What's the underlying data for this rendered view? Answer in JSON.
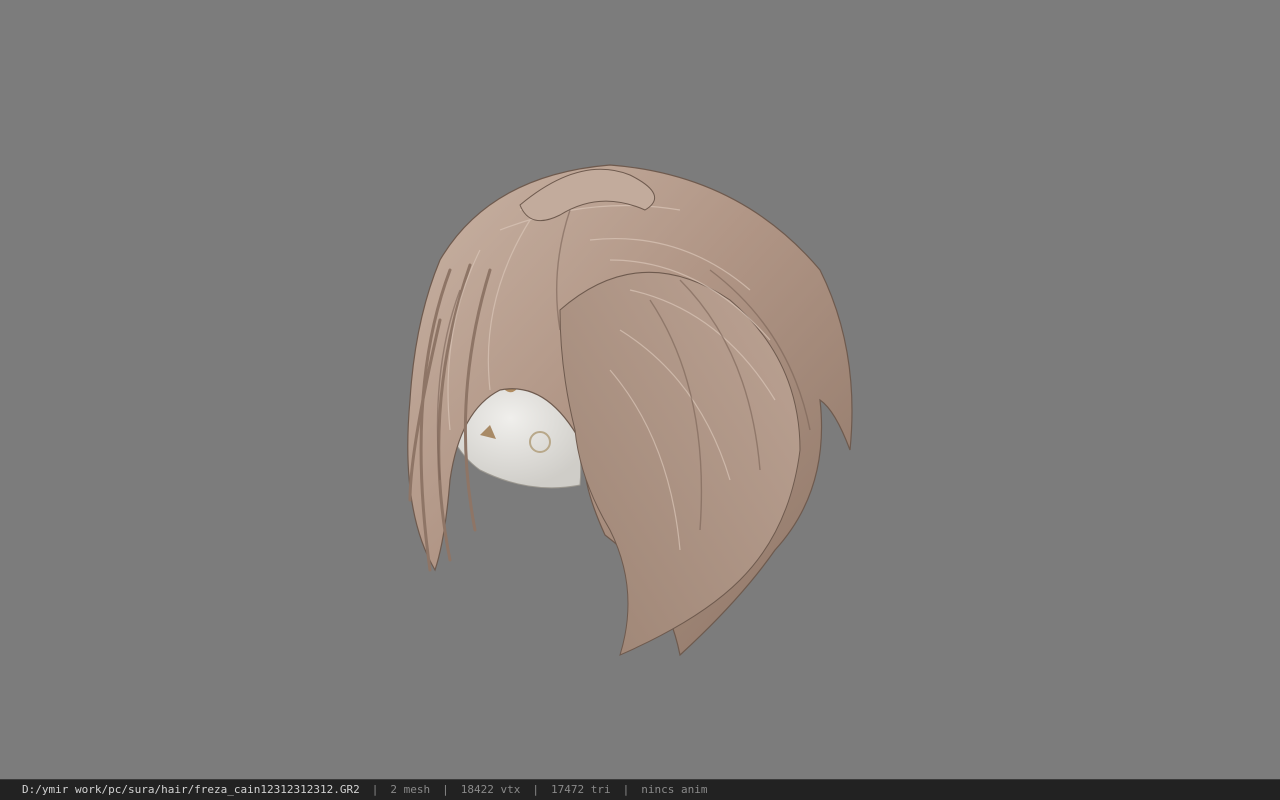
{
  "viewport": {
    "background_color": "#7c7c7c",
    "model": {
      "subject": "hair-model",
      "hair_color": "#b39a8a",
      "cap_color": "#e6e6e2"
    }
  },
  "status_bar": {
    "file_path": "D:/ymir work/pc/sura/hair/freza_cain12312312312.GR2",
    "separator": "|",
    "mesh_count": "2 mesh",
    "vertex_count": "18422 vtx",
    "triangle_count": "17472 tri",
    "animation": "nincs anim"
  }
}
